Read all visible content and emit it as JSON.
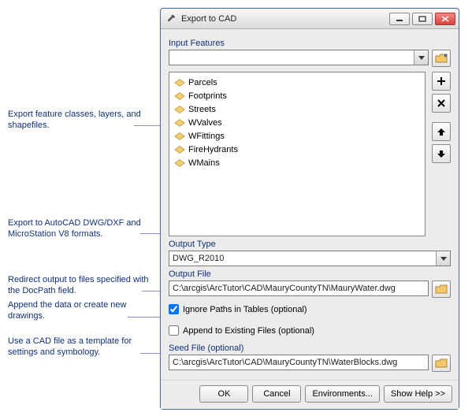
{
  "window": {
    "title": "Export to CAD"
  },
  "annotations": {
    "a1": "Export feature classes, layers, and shapefiles.",
    "a2": "Export to AutoCAD DWG/DXF and MicroStation V8 formats.",
    "a3": "Redirect output to files specified with the DocPath field.",
    "a4": "Append the data or create new drawings.",
    "a5": "Use a CAD file as a template for settings and symbology."
  },
  "input_features": {
    "label": "Input Features",
    "items": [
      "Parcels",
      "Footprints",
      "Streets",
      "WValves",
      "WFittings",
      "FireHydrants",
      "WMains"
    ]
  },
  "output_type": {
    "label": "Output Type",
    "value": "DWG_R2010"
  },
  "output_file": {
    "label": "Output File",
    "value": "C:\\arcgis\\ArcTutor\\CAD\\MauryCountyTN\\MauryWater.dwg"
  },
  "ignore_paths": {
    "label": "Ignore Paths in Tables (optional)",
    "checked": true
  },
  "append_existing": {
    "label": "Append to Existing Files (optional)",
    "checked": false
  },
  "seed_file": {
    "label": "Seed File (optional)",
    "value": "C:\\arcgis\\ArcTutor\\CAD\\MauryCountyTN\\WaterBlocks.dwg"
  },
  "buttons": {
    "ok": "OK",
    "cancel": "Cancel",
    "environments": "Environments...",
    "show_help": "Show Help >>"
  }
}
